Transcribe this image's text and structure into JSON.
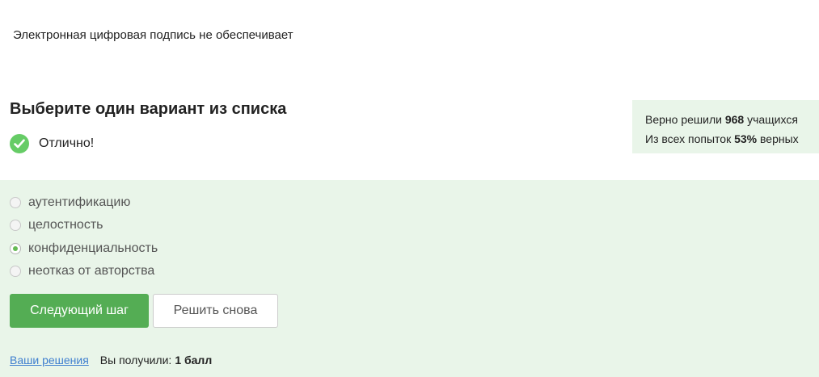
{
  "question": {
    "text": "Электронная цифровая подпись не обеспечивает"
  },
  "prompt": {
    "heading": "Выберите один вариант из списка",
    "status_text": "Отлично!",
    "status_icon": "check-circle-icon"
  },
  "stats": {
    "solved_prefix": "Верно решили",
    "solved_count": "968",
    "solved_suffix": "учащихся",
    "attempts_prefix": "Из всех попыток",
    "attempts_percent": "53%",
    "attempts_suffix": "верных"
  },
  "options": [
    {
      "label": "аутентификацию",
      "selected": false
    },
    {
      "label": "целостность",
      "selected": false
    },
    {
      "label": "конфиденциальность",
      "selected": true
    },
    {
      "label": "неотказ от авторства",
      "selected": false
    }
  ],
  "buttons": {
    "next": "Следующий шаг",
    "retry": "Решить снова"
  },
  "footer": {
    "solutions_link": "Ваши решения",
    "received_label": "Вы получили:",
    "score": "1 балл"
  },
  "colors": {
    "accent_green": "#54ad54",
    "panel_background": "#e9f5e9",
    "link": "#3f7fcf"
  }
}
